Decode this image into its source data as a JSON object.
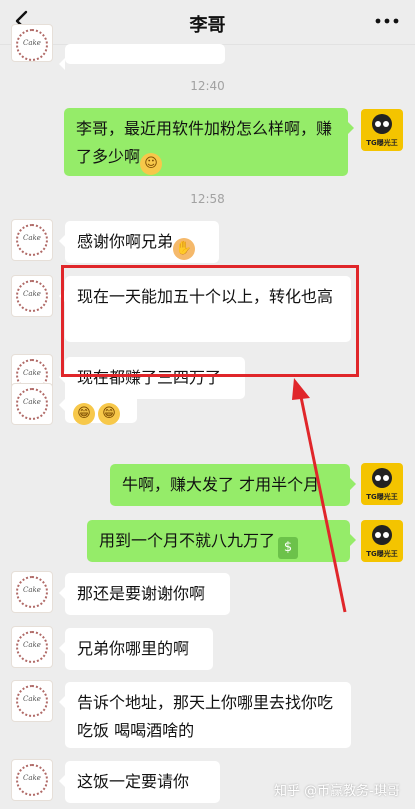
{
  "header": {
    "title": "李哥",
    "back_icon": "chevron-left-icon",
    "more_icon": "more-dots-icon"
  },
  "avatars": {
    "friend_text": "Cake",
    "self_text": "TG曝光王"
  },
  "times": [
    "12:40",
    "12:58"
  ],
  "messages": [
    {
      "id": "m1",
      "side": "out",
      "text": "李哥，最近用软件加粉怎么样啊，赚了多少啊",
      "emoji": "dog-face"
    },
    {
      "id": "m2",
      "side": "in",
      "text": "感谢你啊兄弟",
      "emoji": "handshake"
    },
    {
      "id": "m3",
      "side": "in",
      "text": "现在一天能加五十个以上，转化也高"
    },
    {
      "id": "m4",
      "side": "in",
      "text": "现在都赚了三四万了"
    },
    {
      "id": "m5",
      "side": "in",
      "text": "",
      "emoji": "grin-faces"
    },
    {
      "id": "m6",
      "side": "out",
      "text": "牛啊，赚大发了 才用半个月"
    },
    {
      "id": "m7",
      "side": "out",
      "text": "用到一个月不就八九万了",
      "emoji": "money"
    },
    {
      "id": "m8",
      "side": "in",
      "text": "那还是要谢谢你啊"
    },
    {
      "id": "m9",
      "side": "in",
      "text": "兄弟你哪里的啊"
    },
    {
      "id": "m10",
      "side": "in",
      "text": "告诉个地址，那天上你哪里去找你吃吃饭  喝喝酒啥的"
    },
    {
      "id": "m11",
      "side": "in",
      "text": "这饭一定要请你"
    }
  ],
  "annotation": {
    "highlight_color": "#e0262a"
  },
  "watermark": "知乎 @币赢教务-琪哥",
  "colors": {
    "out_bubble": "#95ec69",
    "in_bubble": "#ffffff",
    "background": "#ededed"
  }
}
